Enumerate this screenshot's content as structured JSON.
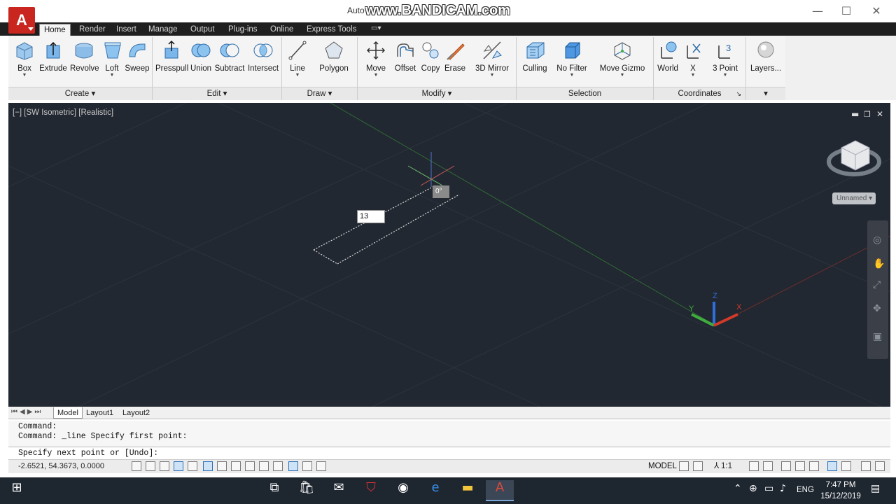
{
  "window": {
    "title": "Auto",
    "watermark": "www.BANDICAM.com",
    "logo_letter": "A",
    "controls": {
      "minimize": "—",
      "maximize": "☐",
      "close": "✕"
    }
  },
  "tabs": [
    {
      "label": "Home",
      "active": true
    },
    {
      "label": "Render"
    },
    {
      "label": "Insert"
    },
    {
      "label": "Manage"
    },
    {
      "label": "Output"
    },
    {
      "label": "Plug-ins"
    },
    {
      "label": "Online"
    },
    {
      "label": "Express Tools"
    }
  ],
  "ribbon": {
    "create": {
      "title": "Create",
      "buttons": [
        "Box",
        "Extrude",
        "Revolve",
        "Loft",
        "Sweep"
      ]
    },
    "edit": {
      "title": "Edit",
      "buttons": [
        "Presspull",
        "Union",
        "Subtract",
        "Intersect"
      ]
    },
    "draw": {
      "title": "Draw",
      "buttons": [
        "Line",
        "Polygon"
      ]
    },
    "modify": {
      "title": "Modify",
      "buttons": [
        "Move",
        "Offset",
        "Copy",
        "Erase",
        "3D Mirror"
      ]
    },
    "selection": {
      "title": "Selection",
      "buttons": [
        "Culling",
        "No Filter",
        "Move Gizmo"
      ]
    },
    "coordinates": {
      "title": "Coordinates",
      "buttons": [
        "World",
        "X",
        "3 Point"
      ]
    },
    "layers": {
      "label": "Layers..."
    }
  },
  "viewport": {
    "label": "[−] [SW Isometric] [Realistic]",
    "dynamic_input": "13",
    "angle_tooltip": "0°",
    "viewcube_label": "Unnamed",
    "ucs": {
      "x": "X",
      "y": "Y",
      "z": "Z"
    },
    "colors": {
      "background": "#222831",
      "x_axis": "#d23a2a",
      "y_axis": "#3fae3f",
      "z_axis": "#2f6fdc"
    }
  },
  "layout_tabs": [
    "Model",
    "Layout1",
    "Layout2"
  ],
  "command": {
    "history": [
      "Command:",
      "Command:  _line Specify first point:"
    ],
    "current": "Specify next point or [Undo]:"
  },
  "status": {
    "coords": "-2.6521, 54.3673, 0.0000",
    "model": "MODEL",
    "scale": "1:1"
  },
  "taskbar": {
    "language": "ENG",
    "time": "7:47 PM",
    "date": "15/12/2019"
  }
}
